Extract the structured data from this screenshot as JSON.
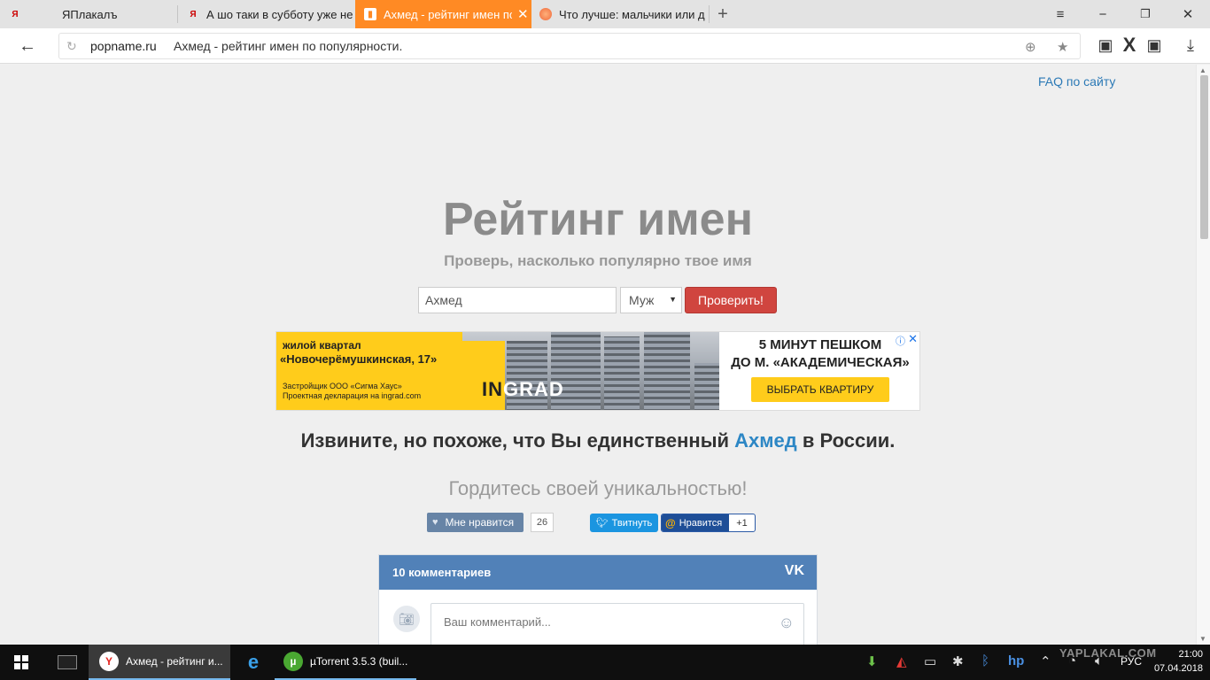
{
  "browser": {
    "tabs": [
      {
        "title": "ЯПлакалъ",
        "active": false
      },
      {
        "title": "А шо таки в субботу уже не",
        "active": false
      },
      {
        "title": "Ахмед - рейтинг имен по",
        "active": true
      },
      {
        "title": "Что лучше: мальчики или д",
        "active": false
      }
    ],
    "new_tab": "+",
    "address": {
      "domain": "popname.ru",
      "title": "Ахмед - рейтинг имен по популярности."
    },
    "window_controls": {
      "menu": "≡",
      "minimize": "−",
      "restore": "❐",
      "close": "✕"
    }
  },
  "page": {
    "faq_link": "FAQ по сайту",
    "title": "Рейтинг имен",
    "subtitle": "Проверь, насколько популярно твое имя",
    "name_input_value": "Ахмед",
    "gender_select": "Муж",
    "check_button": "Проверить!",
    "banner": {
      "line1": "жилой квартал",
      "line2": "«Новочерёмушкинская, 17»",
      "line3": "Застройщик ООО «Сигма Хаус»",
      "line4": "Проектная декларация на ingrad.com",
      "logo_a": "IN",
      "logo_b": "GRAD",
      "right1": "5 МИНУТ ПЕШКОМ",
      "right2": "ДО М. «АКАДЕМИЧЕСКАЯ»",
      "cta": "ВЫБРАТЬ КВАРТИРУ"
    },
    "result": {
      "prefix": "Извините, но похоже, что Вы единственный",
      "name": "Ахмед",
      "suffix": "в России."
    },
    "proud_text": "Гордитесь своей уникальностью!",
    "social": {
      "vk_like": "Мне нравится",
      "vk_like_count": "26",
      "tweet": "Твитнуть",
      "mm_like": "Нравится",
      "mm_count": "+1"
    },
    "comments": {
      "header": "10 комментариев",
      "logo": "VK",
      "placeholder": "Ваш комментарий..."
    }
  },
  "taskbar": {
    "apps": [
      {
        "title": "Ахмед - рейтинг и...",
        "active": true
      },
      {
        "title": "µTorrent 3.5.3  (buil...",
        "active": false
      }
    ],
    "language": "РУС",
    "time": "21:00",
    "date": "07.04.2018",
    "watermark": "YAPLAKAL.COM"
  },
  "colors": {
    "accent_tab": "#ff8a24",
    "check_button": "#d0453f",
    "link": "#2d87c5",
    "vk_header": "#5181b8"
  }
}
